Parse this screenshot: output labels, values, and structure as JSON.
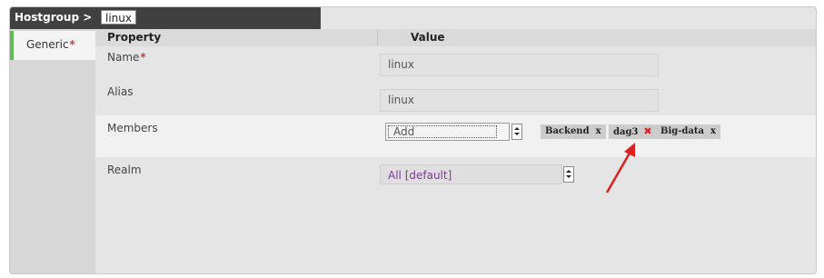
{
  "breadcrumb": {
    "label": "Hostgroup >",
    "current": "linux"
  },
  "tabs": [
    {
      "label": "Generic",
      "required_marker": "*"
    }
  ],
  "table": {
    "header_property": "Property",
    "header_value": "Value"
  },
  "fields": {
    "name": {
      "label": "Name",
      "required_marker": "*",
      "value": "linux"
    },
    "alias": {
      "label": "Alias",
      "value": "linux"
    },
    "members": {
      "label": "Members",
      "add_placeholder": "Add",
      "tags": [
        {
          "label": "Backend",
          "remove": "x"
        },
        {
          "label": "dag3",
          "remove": "✖"
        },
        {
          "label": "Big-data",
          "remove": "x"
        }
      ]
    },
    "realm": {
      "label": "Realm",
      "value": "All [default]"
    }
  },
  "colors": {
    "tab_accent": "#5fba58",
    "required": "#d83a3a",
    "highlight_arrow": "#e02020",
    "realm_text": "#7a3b8f"
  },
  "annotation": {
    "icon": "red-arrow-icon"
  }
}
